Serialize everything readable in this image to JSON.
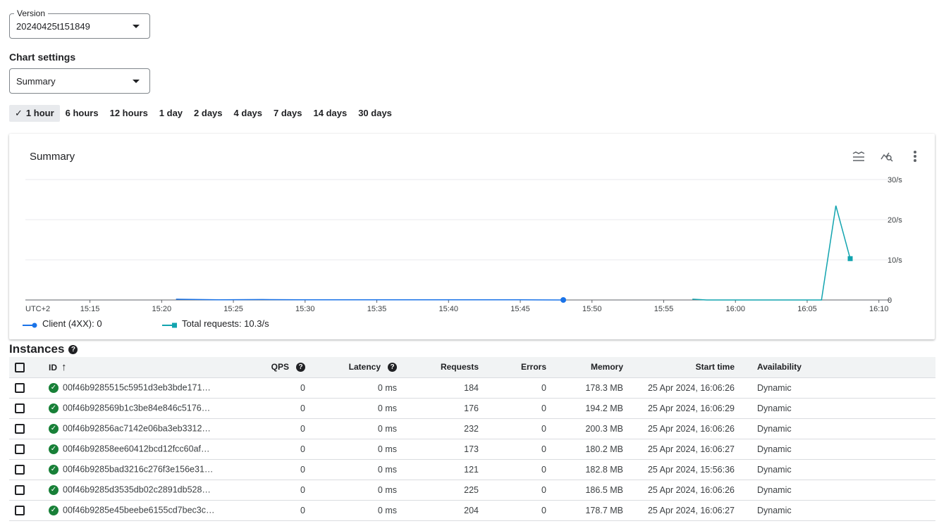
{
  "version_select": {
    "legend": "Version",
    "value": "20240425t151849"
  },
  "chart_settings": {
    "label": "Chart settings",
    "value": "Summary"
  },
  "time_ranges": [
    {
      "label": "1 hour",
      "active": true
    },
    {
      "label": "6 hours",
      "active": false
    },
    {
      "label": "12 hours",
      "active": false
    },
    {
      "label": "1 day",
      "active": false
    },
    {
      "label": "2 days",
      "active": false
    },
    {
      "label": "4 days",
      "active": false
    },
    {
      "label": "7 days",
      "active": false
    },
    {
      "label": "14 days",
      "active": false
    },
    {
      "label": "30 days",
      "active": false
    }
  ],
  "chart_card": {
    "title": "Summary",
    "icons": [
      "compare-lines-icon",
      "explore-chart-icon",
      "more-vert-icon"
    ]
  },
  "chart_data": {
    "type": "line",
    "title": "Summary",
    "timezone_label": "UTC+2",
    "x_ticks": [
      "15:15",
      "15:20",
      "15:25",
      "15:30",
      "15:35",
      "15:40",
      "15:45",
      "15:50",
      "15:55",
      "16:00",
      "16:05",
      "16:10"
    ],
    "y_ticks": [
      "0",
      "10/s",
      "20/s",
      "30/s"
    ],
    "ylim": [
      0,
      30
    ],
    "x_range_minutes": [
      10.5,
      70.8
    ],
    "grid": true,
    "legend_position": "bottom",
    "series": [
      {
        "name": "Client (4XX)",
        "legend_value": "0",
        "color": "#1a73e8",
        "marker": "circle",
        "x_minutes": [
          21,
          24,
          27,
          30,
          35,
          40,
          45,
          48
        ],
        "values": [
          0.2,
          0.05,
          0.1,
          0.05,
          0.05,
          0.05,
          0.05,
          0
        ],
        "marker_at": 48
      },
      {
        "name": "Total requests",
        "legend_value": "10.3/s",
        "color": "#12a4af",
        "marker": "square",
        "x_minutes": [
          57,
          58,
          60,
          62,
          64,
          66,
          67,
          68
        ],
        "values": [
          0.2,
          0,
          0,
          0,
          0,
          0,
          23.5,
          10.3
        ],
        "marker_at": 68
      }
    ]
  },
  "instances": {
    "title": "Instances",
    "columns": {
      "id": "ID",
      "qps": "QPS",
      "latency": "Latency",
      "requests": "Requests",
      "errors": "Errors",
      "memory": "Memory",
      "start_time": "Start time",
      "availability": "Availability"
    },
    "rows": [
      {
        "id": "00f46b9285515c5951d3eb3bde171…",
        "qps": "0",
        "latency": "0 ms",
        "requests": "184",
        "errors": "0",
        "memory": "178.3 MB",
        "start_time": "25 Apr 2024, 16:06:26",
        "availability": "Dynamic"
      },
      {
        "id": "00f46b928569b1c3be84e846c5176…",
        "qps": "0",
        "latency": "0 ms",
        "requests": "176",
        "errors": "0",
        "memory": "194.2 MB",
        "start_time": "25 Apr 2024, 16:06:29",
        "availability": "Dynamic"
      },
      {
        "id": "00f46b92856ac7142e06ba3eb3312…",
        "qps": "0",
        "latency": "0 ms",
        "requests": "232",
        "errors": "0",
        "memory": "200.3 MB",
        "start_time": "25 Apr 2024, 16:06:26",
        "availability": "Dynamic"
      },
      {
        "id": "00f46b92858ee60412bcd12fcc60af…",
        "qps": "0",
        "latency": "0 ms",
        "requests": "173",
        "errors": "0",
        "memory": "180.2 MB",
        "start_time": "25 Apr 2024, 16:06:27",
        "availability": "Dynamic"
      },
      {
        "id": "00f46b9285bad3216c276f3e156e31…",
        "qps": "0",
        "latency": "0 ms",
        "requests": "121",
        "errors": "0",
        "memory": "182.8 MB",
        "start_time": "25 Apr 2024, 15:56:36",
        "availability": "Dynamic"
      },
      {
        "id": "00f46b9285d3535db02c2891db528…",
        "qps": "0",
        "latency": "0 ms",
        "requests": "225",
        "errors": "0",
        "memory": "186.5 MB",
        "start_time": "25 Apr 2024, 16:06:26",
        "availability": "Dynamic"
      },
      {
        "id": "00f46b9285e45beebe6155cd7bec3c…",
        "qps": "0",
        "latency": "0 ms",
        "requests": "204",
        "errors": "0",
        "memory": "178.7 MB",
        "start_time": "25 Apr 2024, 16:06:27",
        "availability": "Dynamic"
      }
    ]
  }
}
